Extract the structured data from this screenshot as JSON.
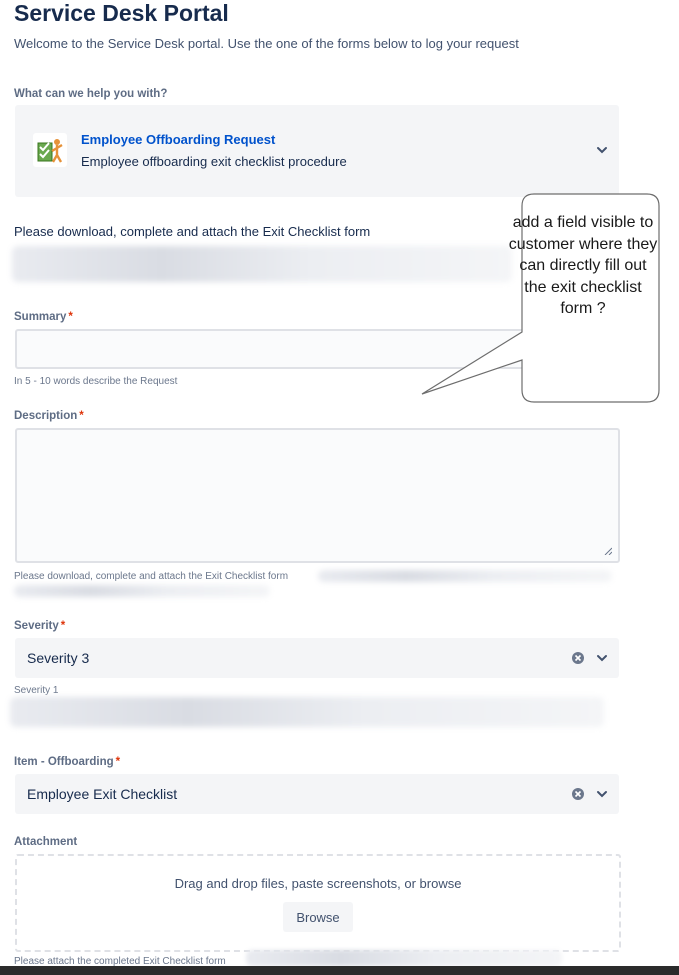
{
  "portal": {
    "title": "Service Desk Portal",
    "welcome": "Welcome to the Service Desk portal. Use the one of the forms below to log your request"
  },
  "request_type": {
    "label": "What can we help you with?",
    "name": "Employee Offboarding Request",
    "description": "Employee offboarding exit checklist procedure"
  },
  "instruction": "Please download, complete and attach the Exit Checklist form",
  "summary": {
    "label": "Summary",
    "required_mark": "*",
    "value": "",
    "helper": "In 5 - 10 words describe the Request"
  },
  "description": {
    "label": "Description",
    "required_mark": "*",
    "value": "",
    "helper": "Please download, complete and attach the Exit Checklist form"
  },
  "severity": {
    "label": "Severity",
    "required_mark": "*",
    "value": "Severity 3",
    "helper": "Severity 1"
  },
  "item": {
    "label": "Item - Offboarding",
    "required_mark": "*",
    "value": "Employee Exit Checklist"
  },
  "attachment": {
    "label": "Attachment",
    "drop_text": "Drag and drop files, paste screenshots, or browse",
    "browse_label": "Browse",
    "helper": "Please attach the completed Exit Checklist form"
  },
  "callout": {
    "text": "add a field visible to customer where they can directly fill out the exit checklist form ?"
  },
  "colors": {
    "title": "#172b4d",
    "link": "#0052cc",
    "required": "#de350b",
    "field_bg": "#f4f5f7",
    "border": "#dfe1e6"
  }
}
